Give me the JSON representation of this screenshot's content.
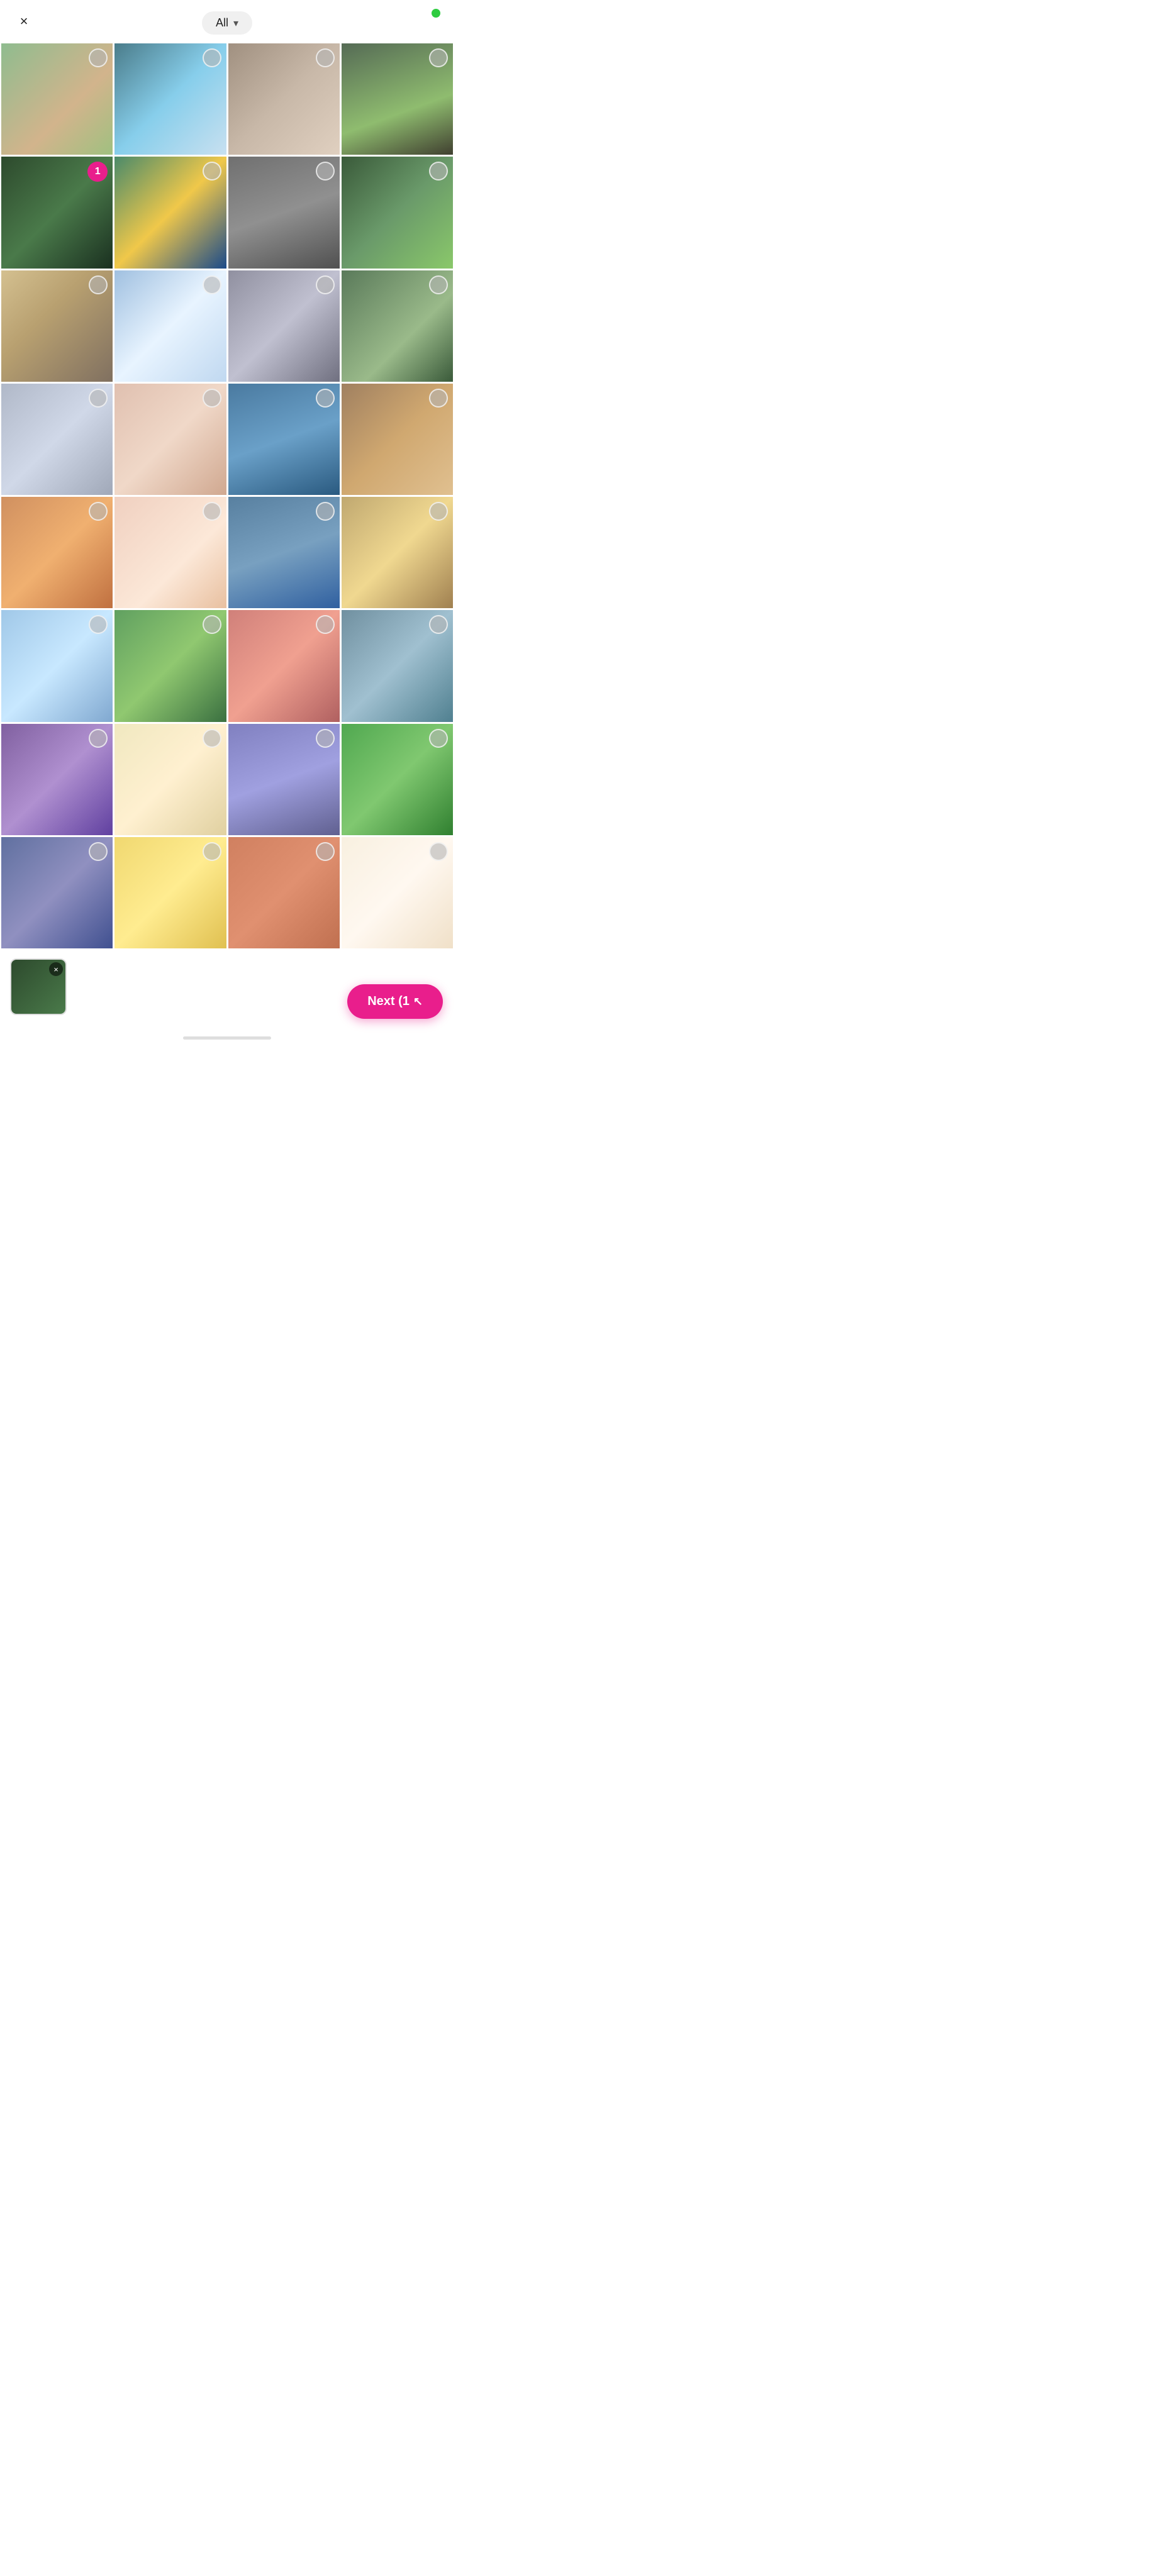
{
  "header": {
    "close_label": "×",
    "filter_label": "All",
    "chevron": "▾"
  },
  "grid": {
    "photos": [
      {
        "id": 1,
        "color": "c1",
        "selected": false,
        "badge": null
      },
      {
        "id": 2,
        "color": "c2",
        "selected": false,
        "badge": null
      },
      {
        "id": 3,
        "color": "c3",
        "selected": false,
        "badge": null
      },
      {
        "id": 4,
        "color": "c4",
        "selected": false,
        "badge": null
      },
      {
        "id": 5,
        "color": "c5",
        "selected": false,
        "badge": "1"
      },
      {
        "id": 6,
        "color": "c6",
        "selected": false,
        "badge": null
      },
      {
        "id": 7,
        "color": "c7",
        "selected": false,
        "badge": null
      },
      {
        "id": 8,
        "color": "c8",
        "selected": false,
        "badge": null
      },
      {
        "id": 9,
        "color": "c9",
        "selected": false,
        "badge": null
      },
      {
        "id": 10,
        "color": "c10",
        "selected": false,
        "badge": null
      },
      {
        "id": 11,
        "color": "c11",
        "selected": false,
        "badge": null
      },
      {
        "id": 12,
        "color": "c12",
        "selected": false,
        "badge": null
      },
      {
        "id": 13,
        "color": "c13",
        "selected": false,
        "badge": null
      },
      {
        "id": 14,
        "color": "c14",
        "selected": false,
        "badge": null
      },
      {
        "id": 15,
        "color": "c15",
        "selected": false,
        "badge": null
      },
      {
        "id": 16,
        "color": "c16",
        "selected": false,
        "badge": null
      },
      {
        "id": 17,
        "color": "c17",
        "selected": false,
        "badge": null
      },
      {
        "id": 18,
        "color": "c18",
        "selected": false,
        "badge": null
      },
      {
        "id": 19,
        "color": "c19",
        "selected": false,
        "badge": null
      },
      {
        "id": 20,
        "color": "c20",
        "selected": false,
        "badge": null
      },
      {
        "id": 21,
        "color": "c21",
        "selected": false,
        "badge": null
      },
      {
        "id": 22,
        "color": "c22",
        "selected": false,
        "badge": null
      },
      {
        "id": 23,
        "color": "c23",
        "selected": false,
        "badge": null
      },
      {
        "id": 24,
        "color": "c24",
        "selected": false,
        "badge": null
      },
      {
        "id": 25,
        "color": "c25",
        "selected": false,
        "badge": null
      },
      {
        "id": 26,
        "color": "c26",
        "selected": false,
        "badge": null
      },
      {
        "id": 27,
        "color": "c27",
        "selected": false,
        "badge": null
      },
      {
        "id": 28,
        "color": "c28",
        "selected": false,
        "badge": null
      },
      {
        "id": 29,
        "color": "c29",
        "selected": false,
        "badge": null
      },
      {
        "id": 30,
        "color": "c30",
        "selected": false,
        "badge": null
      },
      {
        "id": 31,
        "color": "c31",
        "selected": false,
        "badge": null
      },
      {
        "id": 32,
        "color": "c32",
        "selected": false,
        "badge": null
      }
    ]
  },
  "bottom": {
    "preview_close_label": "×",
    "next_button_label": "Next (1",
    "next_count": "1"
  }
}
